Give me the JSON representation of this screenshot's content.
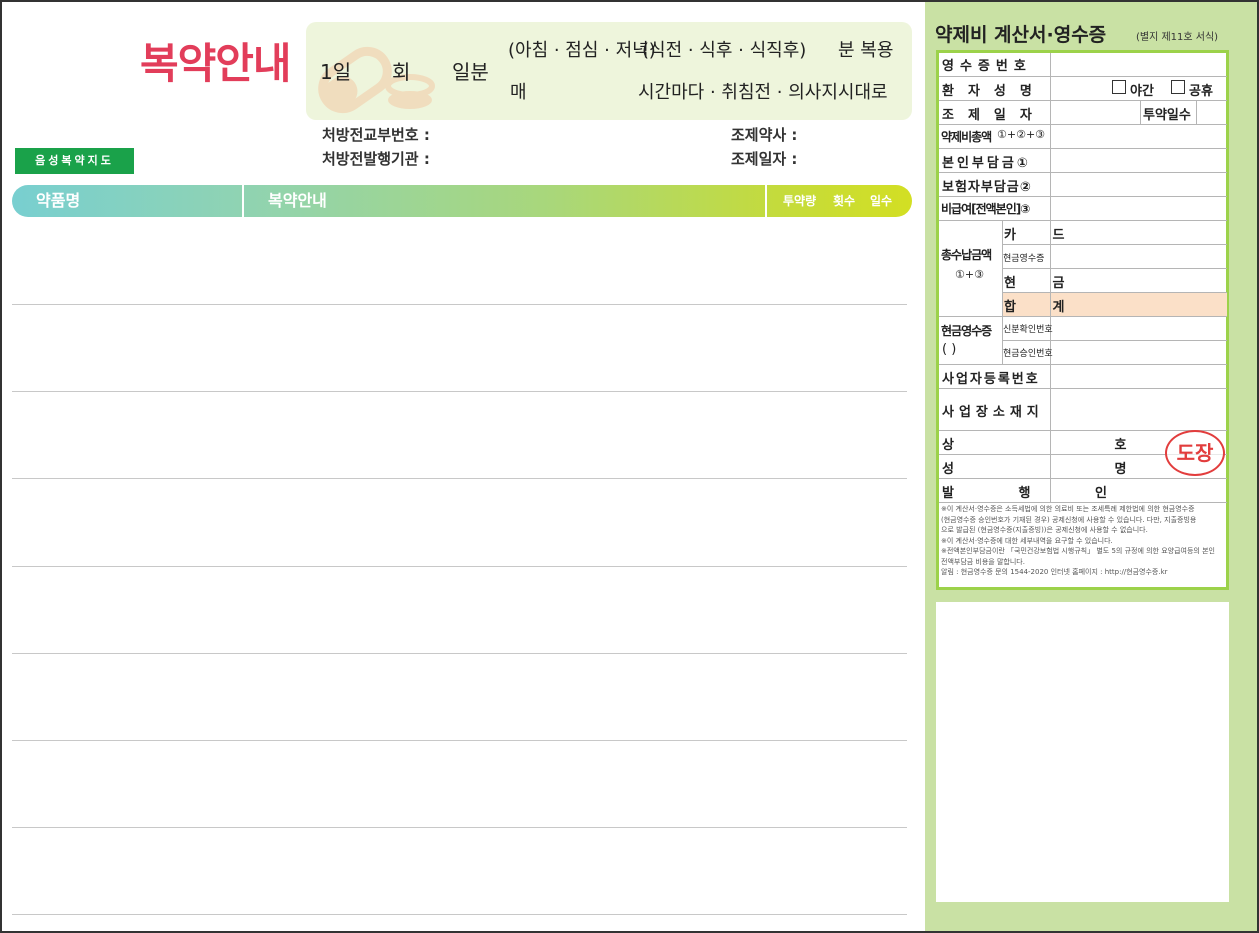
{
  "header": {
    "title": "복약안내",
    "voice_tag": "음성복약지도"
  },
  "dose": {
    "day": "1일",
    "times": "회",
    "portion": "일분",
    "meal_times": "(아침 · 점심 · 저녁)",
    "meal_timing": "(식전 · 식후 · 식직후)",
    "minutes_take": "분 복용",
    "every": "매",
    "other_options": "시간마다 · 취침전 · 의사지시대로"
  },
  "rx": {
    "delivery_number": "처방전교부번호 :",
    "issuing_institution": "처방전발행기관 :",
    "pharmacist": "조제약사 :",
    "dispense_date": "조제일자 :"
  },
  "columns": {
    "drug_name": "약품명",
    "guidance": "복약안내",
    "dose_amount": "투약량",
    "frequency": "횟수",
    "days": "일수"
  },
  "receipt": {
    "title": "약제비 계산서·영수증",
    "subtitle": "(별지 제11호 서식)",
    "rows": {
      "receipt_no": "영수증번호",
      "patient_name": "환자성명",
      "night": "야간",
      "holiday": "공휴",
      "dispense_date": "조제일자",
      "days_given": "투약일수",
      "total_cost": "약제비총액",
      "total_cost_formula": "①+②+③",
      "self_pay": "본인부담금①",
      "insurer_pay": "보험자부담금②",
      "non_covered": "비급여[전액본인]③",
      "total_paid": "총수납금액",
      "total_paid_formula": "①+③",
      "card": "카 드",
      "cash_receipt_small": "현금영수증",
      "cash": "현 금",
      "sum": "합 계",
      "cash_receipt": "현금영수증",
      "cash_receipt_paren": "(      )",
      "id_number": "신분확인번호",
      "approval_number": "현금승인번호",
      "business_reg_no": "사업자등록번호",
      "business_address": "사업장소재지",
      "company": "상 호",
      "name": "성 명",
      "issuer": "발 행 인",
      "stamp": "도장"
    },
    "notes": [
      "※이 계산서·영수증은 소득세법에 의한 의료비 또는 조세특례 제한법에 의한 현금영수증",
      "  (현금영수증 승인번호가 기재된 경우) 공제신청에 사용할 수 있습니다. 다만, 지출증빙용",
      "  으로 발급된 (현금영수증(지출증빙))은 공제신청에 사용할 수 없습니다.",
      "※이 계산서·영수증에 대한 세부내역을 요구할 수 있습니다.",
      "※전액본인부담금이란 「국민건강보험법 시행규칙」 별도 5의 규정에 의한 요양급여등의 본인",
      "  전액부담금 비용을 말합니다.",
      "  알림 : 현금영수증 문의 1544-2020    인터넷 홈페이지 : http://현금영수증.kr"
    ]
  }
}
